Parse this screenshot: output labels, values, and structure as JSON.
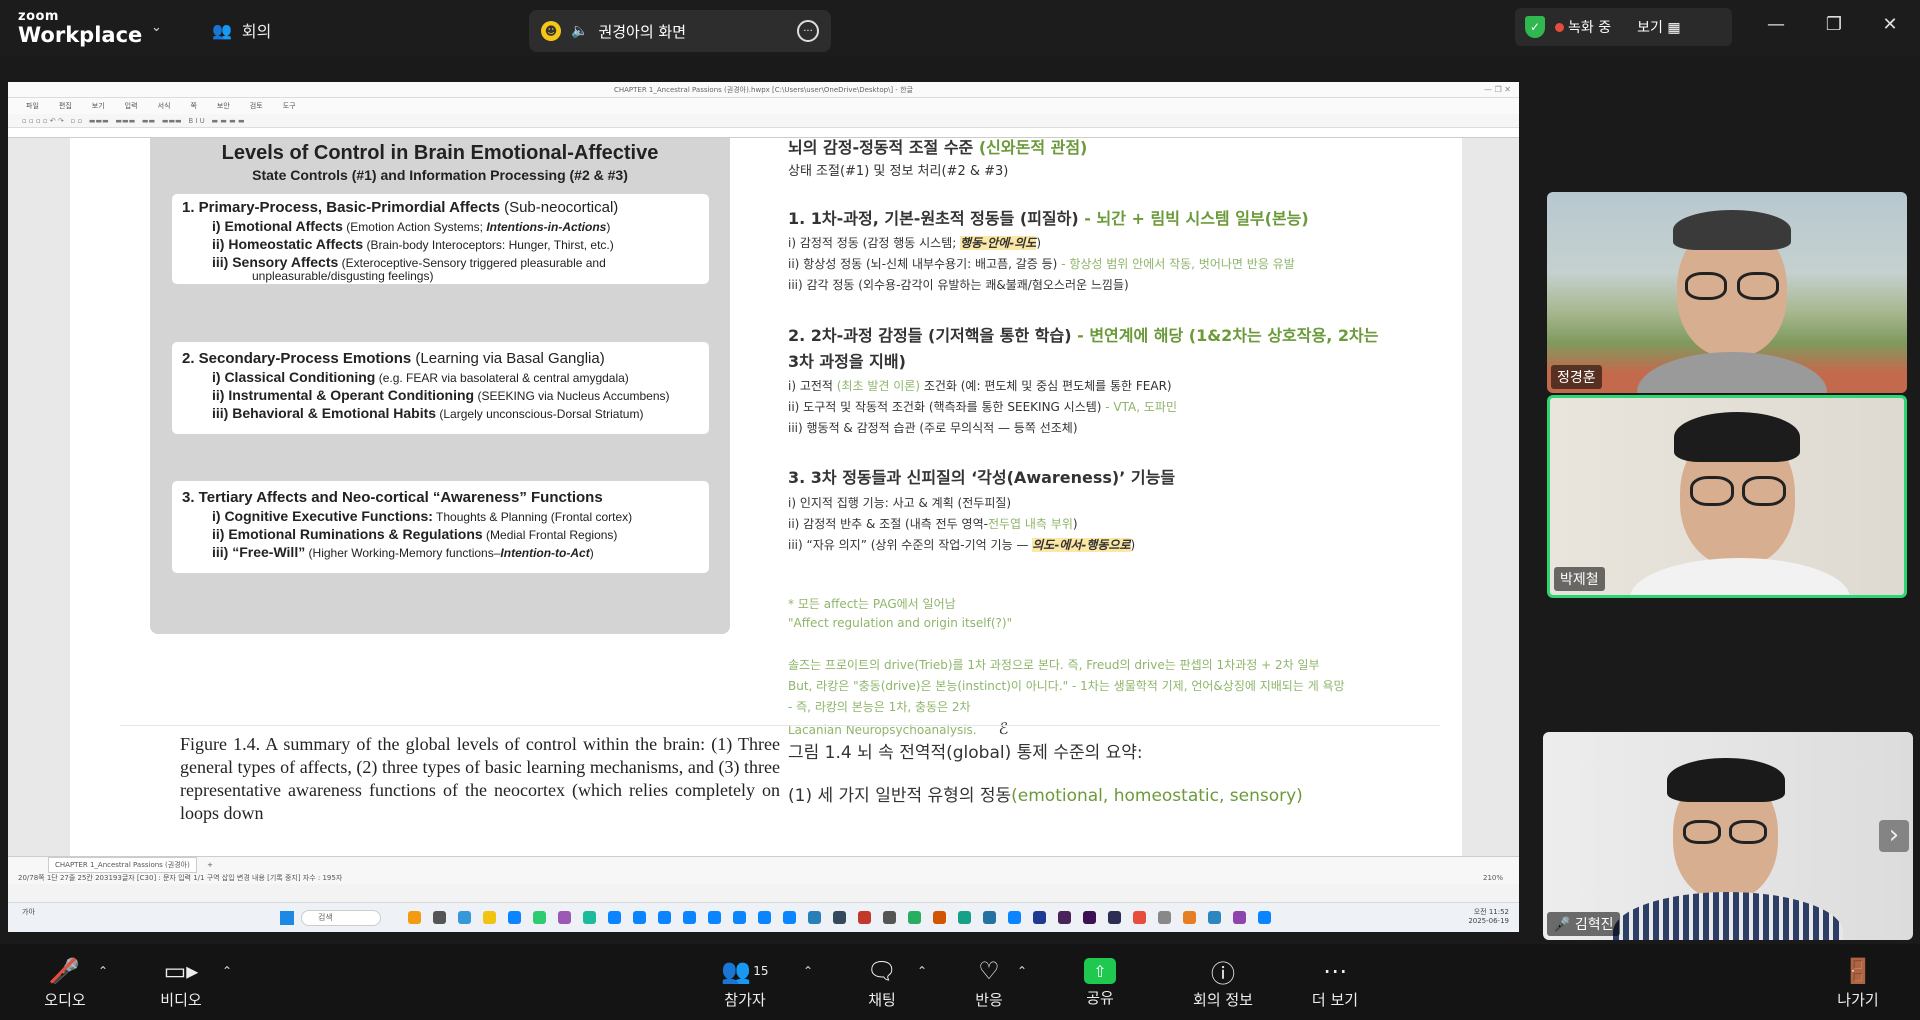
{
  "zoom": {
    "logo_small": "zoom",
    "logo_big": "Workplace",
    "meeting_label": "회의",
    "share_banner": "권경아의 화면",
    "recording": "녹화 중",
    "view": "보기"
  },
  "hwp": {
    "title": "CHAPTER 1_Ancestral Passions (권경아).hwpx [C:\\Users\\user\\OneDrive\\Desktop\\] - 한글",
    "menus": [
      "파일",
      "편집",
      "보기",
      "입력",
      "서식",
      "쪽",
      "보안",
      "검토",
      "도구"
    ],
    "tab": "CHAPTER 1_Ancestral Passions (권경아)",
    "status": "20/78쪽   1단   27줄   25칸   203193글자   [C30] : 문자 입력   1/1 구역   삽입   변경 내용 [기록 중지]   자수 : 195자",
    "zoom_value": "210%",
    "taskbar_search": "검색",
    "clock_time": "오전 11:52",
    "clock_date": "2025-06-19",
    "weather": "가아"
  },
  "figure": {
    "title1": "Levels of Control in Brain Emotional-Affective",
    "title2": "State Controls (#1) and Information Processing (#2 & #3)",
    "box1": {
      "heading": "1.  Primary-Process, Basic-Primordial Affects",
      "heading_note": " (Sub-neocortical)",
      "items": [
        {
          "label": "i) Emotional Affects",
          "desc": " (Emotion Action Systems; ",
          "em": "Intentions-in-Actions",
          "tail": ")"
        },
        {
          "label": "ii) Homeostatic Affects",
          "desc": " (Brain-body Interoceptors: Hunger, Thirst, etc.)",
          "em": "",
          "tail": ""
        },
        {
          "label": "iii) Sensory Affects",
          "desc": " (Exteroceptive-Sensory triggered pleasurable and",
          "em": "",
          "tail": ""
        }
      ],
      "cont": "unpleasurable/disgusting feelings)"
    },
    "box2": {
      "heading": "2.  Secondary-Process Emotions",
      "heading_note": " (Learning via Basal Ganglia)",
      "items": [
        {
          "label": "i)  Classical Conditioning",
          "desc": " (e.g. FEAR via basolateral & central amygdala)"
        },
        {
          "label": "ii)  Instrumental & Operant Conditioning",
          "desc": " (SEEKING via Nucleus Accumbens)"
        },
        {
          "label": "iii)  Behavioral & Emotional Habits",
          "desc": " (Largely unconscious-Dorsal Striatum)"
        }
      ]
    },
    "box3": {
      "heading": "3.  Tertiary Affects and Neo-cortical “Awareness” Functions",
      "items": [
        {
          "label": "i) Cognitive Executive Functions:",
          "desc": " Thoughts & Planning (Frontal cortex)",
          "em": "",
          "tail": ""
        },
        {
          "label": "ii) Emotional Ruminations & Regulations",
          "desc": " (Medial Frontal Regions)",
          "em": "",
          "tail": ""
        },
        {
          "label": "iii) “Free-Will”",
          "desc": " (Higher Working-Memory functions–",
          "em": "Intention-to-Act",
          "tail": ")"
        }
      ]
    }
  },
  "korean": {
    "top_heading": "뇌의 감정-정동적 조절 수준",
    "top_heading_green": " (신와돈적 관점)",
    "subtitle": "상태 조절(#1) 및 정보 처리(#2 & #3)",
    "s1_heading": "1. 1차-과정, 기본-원초적 정동들 (피질하)",
    "s1_green": " - 뇌간 + 림빅 시스템 일부(본능)",
    "s1_i": "i) 감정적 정동 (감정 행동 시스템; ",
    "s1_i_em": "행동-안에-의도",
    "s1_i_tail": ")",
    "s1_ii": "ii) 항상성 정동 (뇌-신체 내부수용기: 배고픔, 갈증 등)",
    "s1_ii_green": " - 항상성 범위 안에서 작동, 벗어나면 반응 유발",
    "s1_iii": "iii) 감각 정동 (외수용-감각이 유발하는 쾌&불쾌/혐오스러운 느낌들)",
    "s2_heading": "2. 2차-과정 감정들 (기저핵을 통한 학습)",
    "s2_green": " - 변연계에 해당 (1&2차는 상호작용, 2차는",
    "s2_green2": "3차 과정을 지배)",
    "s2_i_a": "i) 고전적 ",
    "s2_i_green": "(최초 발견 이론)",
    "s2_i_b": " 조건화 (예: 편도체 및 중심 편도체를 통한 FEAR)",
    "s2_ii": "ii) 도구적 및 작동적 조건화 (핵측좌를 통한 SEEKING 시스템)",
    "s2_ii_green": " - VTA, 도파민",
    "s2_iii": "iii) 행동적 & 감정적 습관 (주로 무의식적 — 등쪽 선조체)",
    "s3_heading": "3. 3차 정동들과 신피질의 ‘각성(Awareness)’ 기능들",
    "s3_i": "i) 인지적 집행 기능: 사고 & 계획 (전두피질)",
    "s3_ii": "ii) 감정적 반추 & 조절 (내측 전두 영역-",
    "s3_ii_green": "전두엽 내측 부위",
    "s3_ii_tail": ")",
    "s3_iii": "iii) “자유 의지” (상위 수준의 작업-기억 기능 — ",
    "s3_iii_em": "의도-에서-행동으로",
    "s3_iii_tail": ")",
    "note1": "* 모든 affect는 PAG에서 일어남",
    "note2": "\"Affect regulation and origin itself(?)\"",
    "note3": "솔즈는 프로이트의 drive(Trieb)를 1차 과정으로 본다. 즉, Freud의 drive는 판셉의 1차과정 + 2차 일부",
    "note4": "But, 라캉은 \"충동(drive)은 본능(instinct)이 아니다.\" - 1차는 생물학적 기제, 언어&상징에 지배되는 게 욕망",
    "note5": "- 즉, 라캉의 본능은 1차, 충동은 2차",
    "note6": "Lacanian Neuropsychoanalysis."
  },
  "caption": {
    "en": "Figure 1.4. A summary of the global levels of control within the brain: (1) Three general types of affects, (2) three types of basic learning mechanisms, and (3) three representative awareness functions of the neocortex (which relies completely on loops down",
    "kr": "그림 1.4 뇌 속 전역적(global) 통제 수준의 요약:",
    "kr2_a": "(1) 세 가지 일반적 유형의 정동",
    "kr2_b": "(emotional, homeostatic, sensory)"
  },
  "participants": [
    {
      "name": "정경훈"
    },
    {
      "name": "박제철"
    },
    {
      "name": "김혁진"
    }
  ],
  "toolbar": {
    "audio": "오디오",
    "video": "비디오",
    "participants": "참가자",
    "participants_count": "15",
    "chat": "채팅",
    "reactions": "반응",
    "share": "공유",
    "meeting_info": "회의 정보",
    "more": "더 보기",
    "leave": "나가기"
  }
}
